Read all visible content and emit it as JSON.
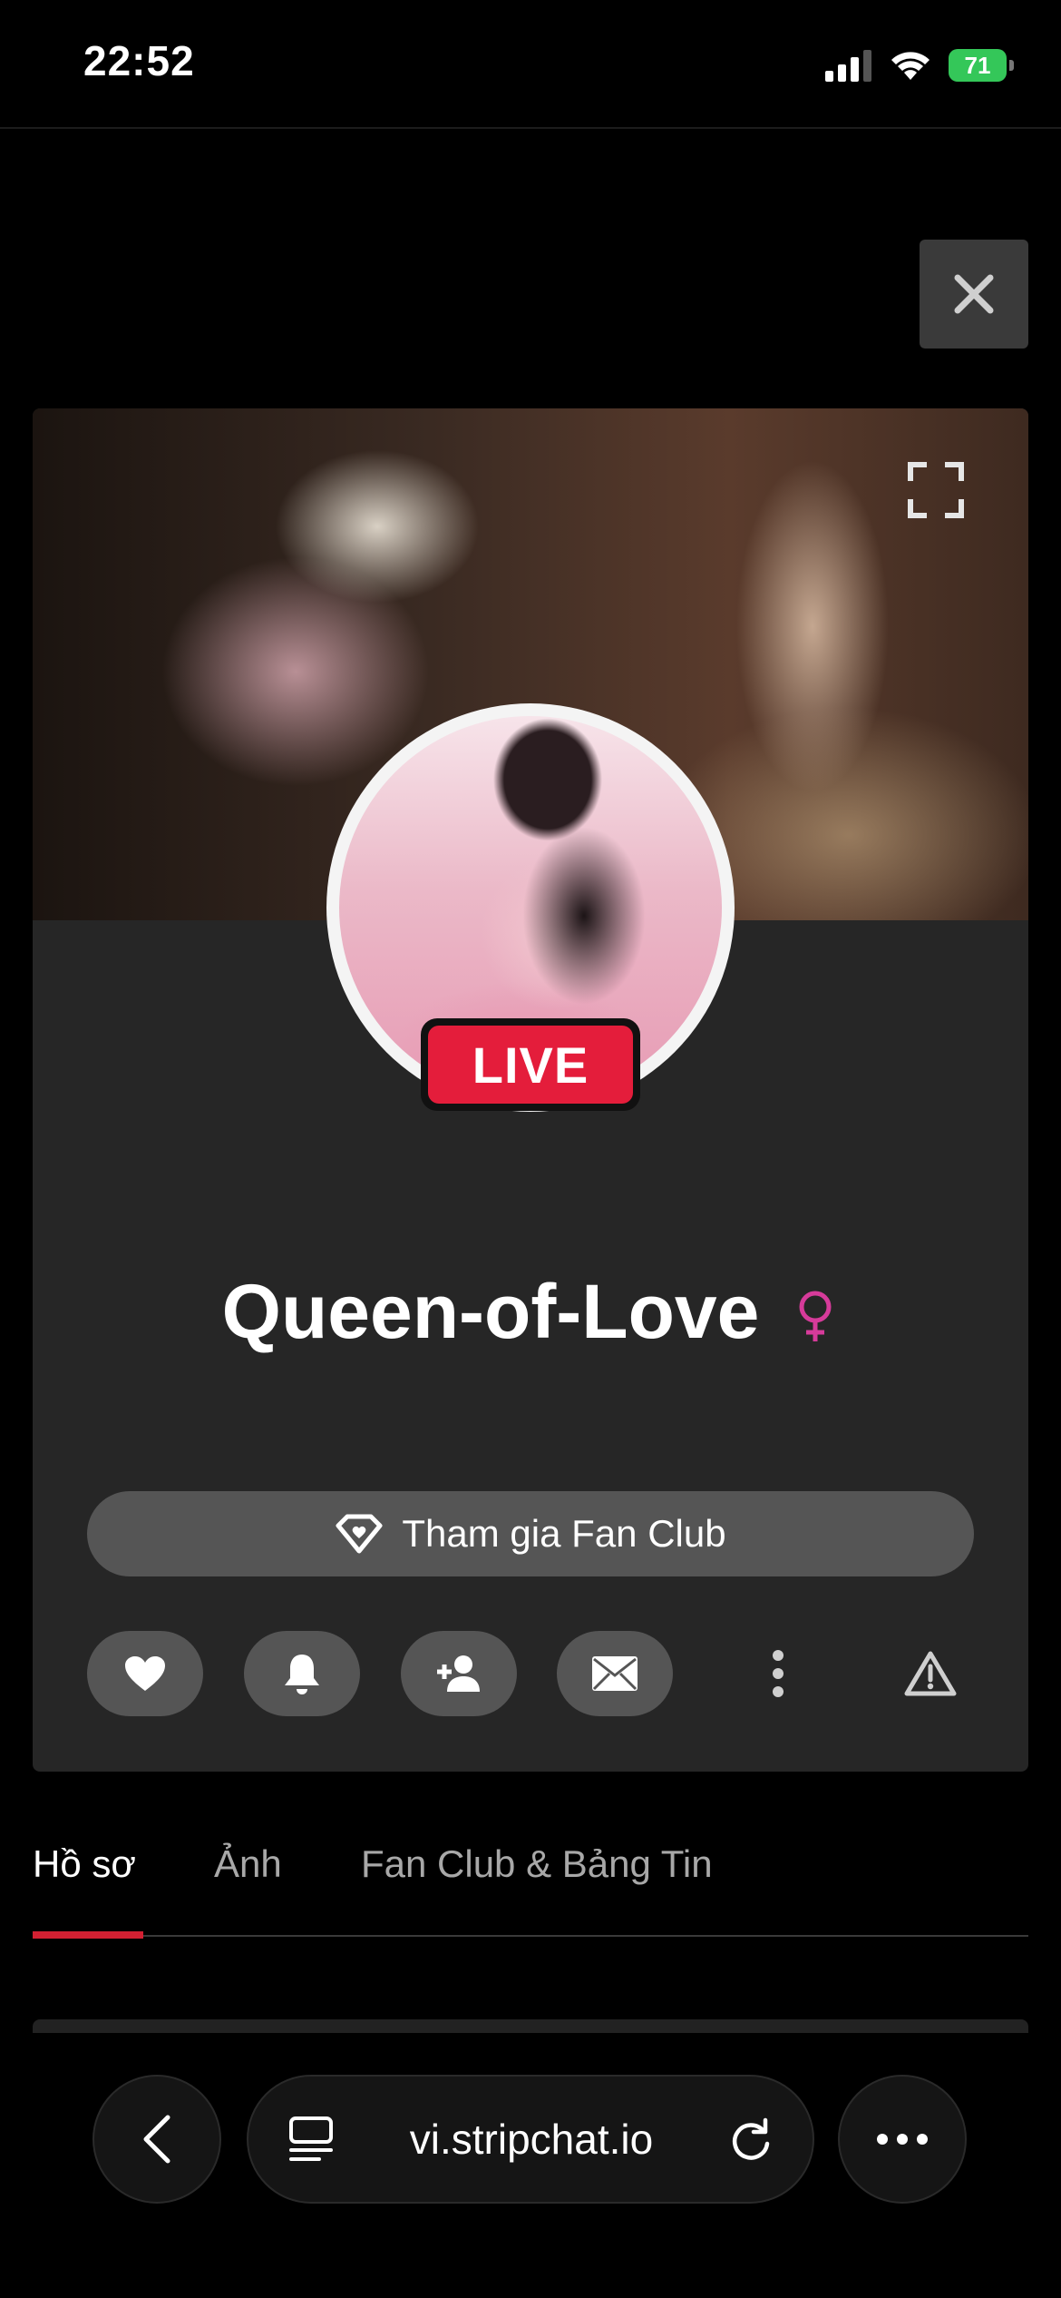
{
  "status_bar": {
    "time": "22:52",
    "battery": "71"
  },
  "profile": {
    "username": "Queen-of-Love",
    "live_label": "LIVE",
    "fan_club_button": "Tham gia Fan Club"
  },
  "tabs": [
    {
      "label": "Hồ sơ"
    },
    {
      "label": "Ảnh"
    },
    {
      "label": "Fan Club & Bảng Tin"
    }
  ],
  "browser": {
    "url": "vi.stripchat.io"
  },
  "colors": {
    "live_red": "#e41d3b",
    "tab_underline": "#d32032",
    "gender_pink": "#d63b9a",
    "battery_green": "#34c759"
  }
}
